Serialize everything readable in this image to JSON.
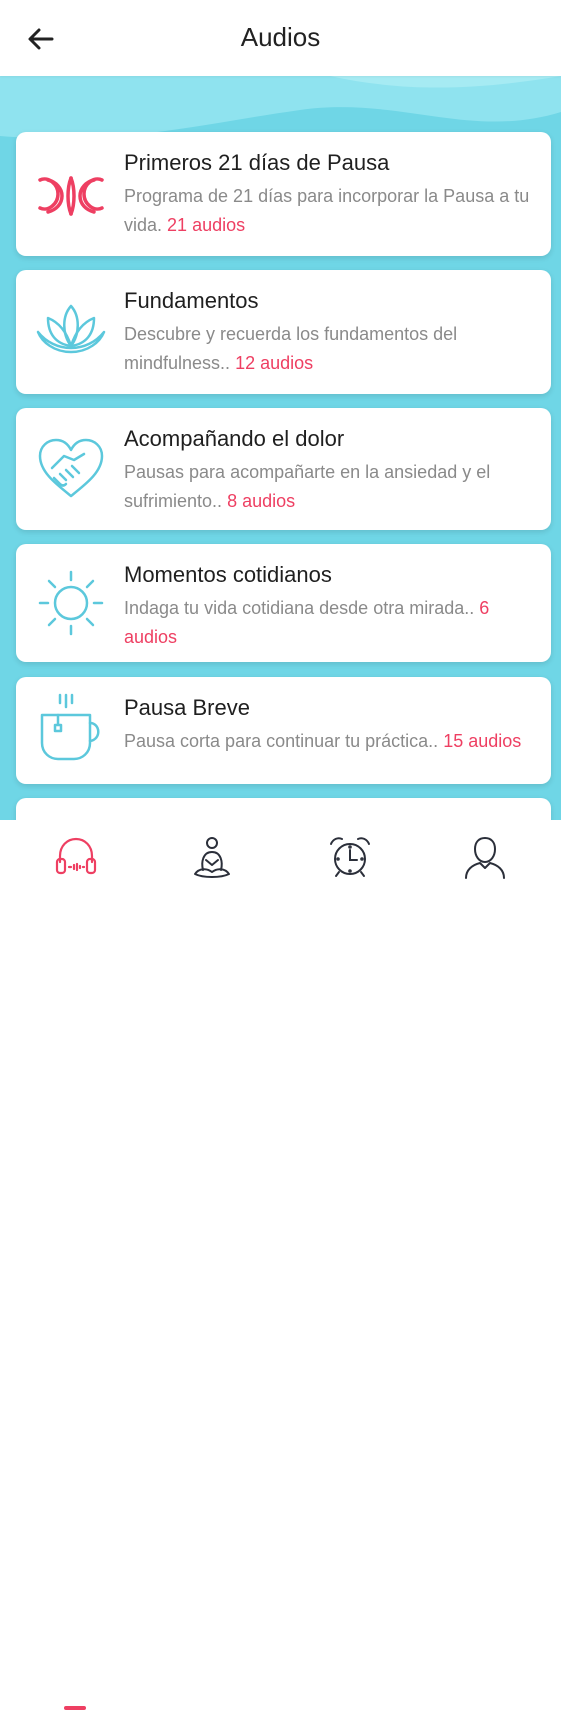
{
  "header": {
    "title": "Audios"
  },
  "categories": [
    {
      "title": "Primeros 21 días de Pausa",
      "description": "Programa de 21 días para incorporar la Pausa a tu vida.",
      "count": "21 audios",
      "icon": "butterfly-icon"
    },
    {
      "title": "Fundamentos",
      "description": "Descubre y recuerda los fundamentos del mindfulness..",
      "count": "12 audios",
      "icon": "lotus-icon"
    },
    {
      "title": "Acompañando el dolor",
      "description": "Pausas para acompañarte en la ansiedad y el sufrimiento..",
      "count": "8 audios",
      "icon": "heart-handshake-icon"
    },
    {
      "title": "Momentos cotidianos",
      "description": "Indaga tu vida cotidiana desde otra mirada..",
      "count": "6 audios",
      "icon": "sun-icon"
    },
    {
      "title": "Pausa Breve",
      "description": "Pausa corta para continuar tu práctica..",
      "count": "15 audios",
      "icon": "tea-cup-icon"
    }
  ],
  "tabs": [
    {
      "icon": "headphones-icon",
      "active": true
    },
    {
      "icon": "meditation-icon",
      "active": false
    },
    {
      "icon": "alarm-clock-icon",
      "active": false
    },
    {
      "icon": "profile-icon",
      "active": false
    }
  ],
  "colors": {
    "accent": "#ee3f62",
    "icon": "#5cc8dc",
    "background": "#6fd6e6"
  }
}
